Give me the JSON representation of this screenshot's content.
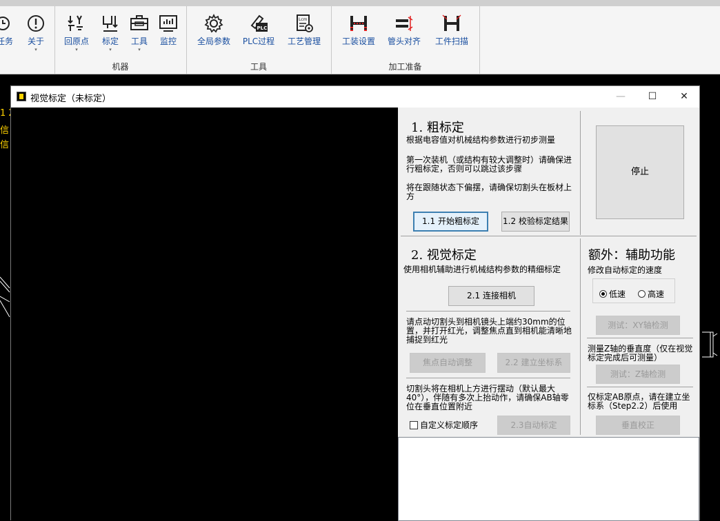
{
  "ribbon": {
    "partial_buttons": [
      {
        "label": "任务"
      },
      {
        "label": "关于"
      }
    ],
    "machine": {
      "label": "机器",
      "buttons": [
        {
          "label": "回原点"
        },
        {
          "label": "标定"
        },
        {
          "label": "工具"
        },
        {
          "label": "监控"
        }
      ]
    },
    "tools": {
      "label": "工具",
      "buttons": [
        {
          "label": "全局参数"
        },
        {
          "label": "PLC过程"
        },
        {
          "label": "工艺管理"
        }
      ]
    },
    "prep": {
      "label": "加工准备",
      "buttons": [
        {
          "label": "工装设置"
        },
        {
          "label": "管头对齐"
        },
        {
          "label": "工件扫描"
        }
      ]
    },
    "plc_icon_text": "PLC",
    "lcm_icon_text": "Lcm"
  },
  "background": {
    "side_texts": [
      "1 2",
      "信",
      "信"
    ]
  },
  "dialog": {
    "title": "视觉标定（未标定）",
    "controls": {
      "minimize": "—",
      "maximize": "☐",
      "close": "✕"
    },
    "coarse": {
      "heading": "1. 粗标定",
      "desc": "根据电容值对机械结构参数进行初步测量",
      "note1": "第一次装机（或结构有较大调整时）请确保进行粗标定，否则可以跳过该步骤",
      "note2": "将在跟随状态下偏摆，请确保切割头在板材上方",
      "start_btn": "1.1 开始粗标定",
      "verify_btn": "1.2 校验标定结果"
    },
    "stop_btn": "停止",
    "visual": {
      "heading": "2. 视觉标定",
      "desc": "使用相机辅助进行机械结构参数的精细标定",
      "connect_btn": "2.1 连接相机",
      "note1": "请点动切割头到相机镜头上端约30mm的位置，并打开红光，调整焦点直到相机能清晰地捕捉到红光",
      "focus_btn": "焦点自动调整",
      "coord_btn": "2.2 建立坐标系",
      "note2": "切割头将在相机上方进行摆动（默认最大40°），伴随有多次上抬动作，请确保AB轴零位在垂直位置附近",
      "custom_order": "自定义标定顺序",
      "auto_btn": "2.3自动标定"
    },
    "extra": {
      "heading": "额外：辅助功能",
      "speed_label": "修改自动标定的速度",
      "speed_options": [
        {
          "label": "低速",
          "selected": true
        },
        {
          "label": "高速",
          "selected": false
        }
      ],
      "xy_test_btn": "测试：XY轴检测",
      "z_note": "测量Z轴的垂直度（仅在视觉标定完成后可测量）",
      "z_test_btn": "测试：Z轴检测",
      "ab_note": "仅标定AB原点，请在建立坐标系（Step2.2）后使用",
      "vertical_btn": "垂直校正"
    }
  }
}
